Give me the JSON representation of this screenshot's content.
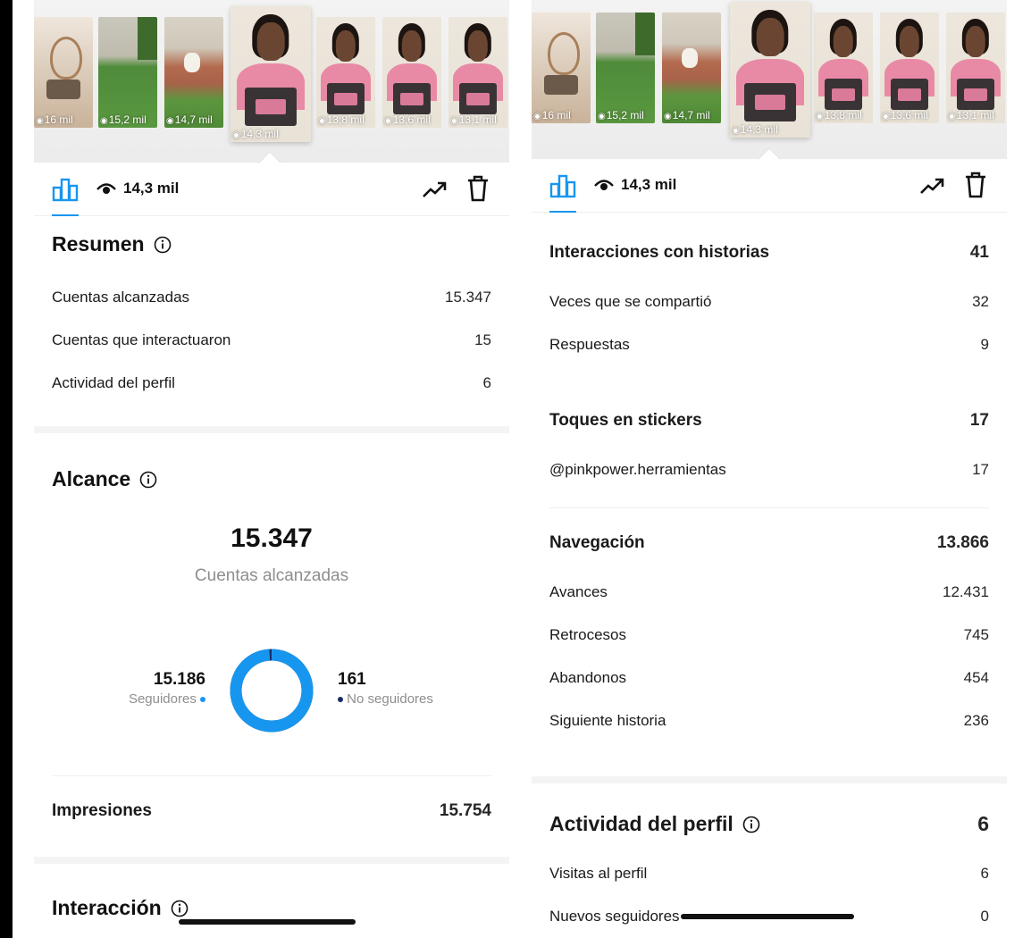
{
  "thumbnails": [
    {
      "label": "16 mil",
      "scene": "room"
    },
    {
      "label": "15,2 mil",
      "scene": "grass"
    },
    {
      "label": "14,7 mil",
      "scene": "dog"
    },
    {
      "label": "14,3 mil",
      "scene": "person",
      "selected": true
    },
    {
      "label": "13,8 mil",
      "scene": "person"
    },
    {
      "label": "13,6 mil",
      "scene": "person"
    },
    {
      "label": "13,1 mil",
      "scene": "person"
    }
  ],
  "toolbar": {
    "views": "14,3 mil",
    "accent_color": "#1796ef"
  },
  "left": {
    "resumen": {
      "title": "Resumen",
      "rows": [
        {
          "label": "Cuentas alcanzadas",
          "value": "15.347"
        },
        {
          "label": "Cuentas que interactuaron",
          "value": "15"
        },
        {
          "label": "Actividad del perfil",
          "value": "6"
        }
      ]
    },
    "alcance": {
      "title": "Alcance",
      "total": "15.347",
      "total_label": "Cuentas alcanzadas",
      "followers_value": "15.186",
      "followers_label": "Seguidores",
      "followers_color": "#1796ef",
      "non_followers_value": "161",
      "non_followers_label": "No seguidores",
      "non_followers_color": "#1a2b66",
      "followers_fraction": 0.9895
    },
    "impresiones": {
      "label": "Impresiones",
      "value": "15.754"
    },
    "interaccion": {
      "title": "Interacción"
    }
  },
  "right": {
    "interacciones": {
      "title": "Interacciones con historias",
      "value": "41",
      "rows": [
        {
          "label": "Veces que se compartió",
          "value": "32"
        },
        {
          "label": "Respuestas",
          "value": "9"
        }
      ]
    },
    "toques": {
      "title": "Toques en stickers",
      "value": "17",
      "rows": [
        {
          "label": "@pinkpower.herramientas",
          "value": "17"
        }
      ]
    },
    "navegacion": {
      "title": "Navegación",
      "value": "13.866",
      "rows": [
        {
          "label": "Avances",
          "value": "12.431"
        },
        {
          "label": "Retrocesos",
          "value": "745"
        },
        {
          "label": "Abandonos",
          "value": "454"
        },
        {
          "label": "Siguiente historia",
          "value": "236"
        }
      ]
    },
    "actividad": {
      "title": "Actividad del perfil",
      "value": "6",
      "rows": [
        {
          "label": "Visitas al perfil",
          "value": "6"
        },
        {
          "label": "Nuevos seguidores",
          "value": "0"
        }
      ]
    }
  }
}
